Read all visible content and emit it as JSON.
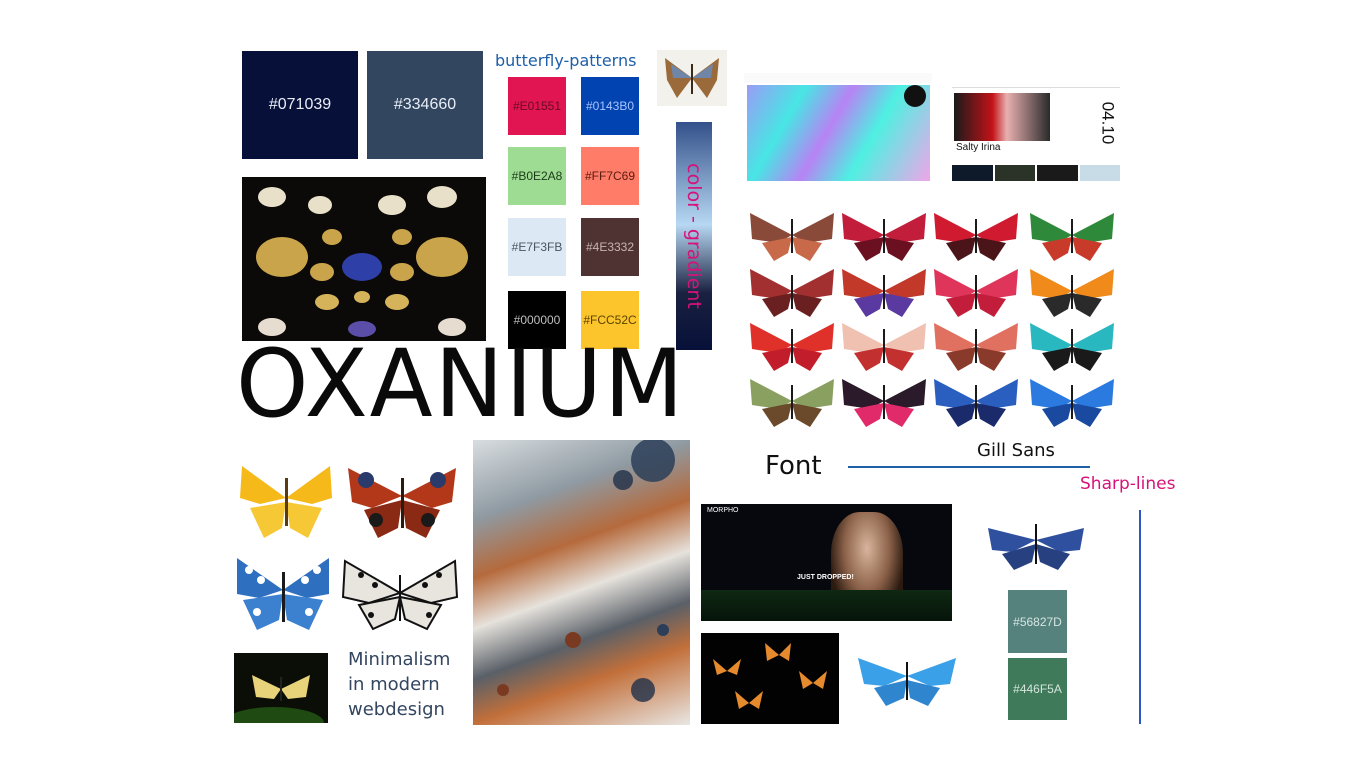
{
  "headline": "OXANIUM",
  "patterns_title": "butterfly-patterns",
  "gradient_label": "color - gradient",
  "font_label": "Font",
  "font_name": "Gill Sans",
  "sharp_lines_label": "Sharp-lines",
  "minimalism_text": [
    "Minimalism",
    "in modern",
    "webdesign"
  ],
  "large_swatches": [
    {
      "hex": "#071039",
      "label": "#071039"
    },
    {
      "hex": "#334660",
      "label": "#334660"
    }
  ],
  "pattern_swatches": [
    {
      "hex": "#E01551",
      "label": "#E01551"
    },
    {
      "hex": "#0143B0",
      "label": "#0143B0"
    },
    {
      "hex": "#B0E2A8",
      "label": "#B0E2A8"
    },
    {
      "hex": "#FF7C69",
      "label": "#FF7C69"
    },
    {
      "hex": "#E7F3FB",
      "label": "#E7F3FB"
    },
    {
      "hex": "#4E3332",
      "label": "#4E3332"
    },
    {
      "hex": "#000000",
      "label": "#000000"
    },
    {
      "hex": "#FCC52C",
      "label": "#FCC52C"
    }
  ],
  "green_swatches": [
    {
      "hex": "#56827D",
      "label": "#56827D"
    },
    {
      "hex": "#446F5A",
      "label": "#446F5A"
    }
  ],
  "web_mockup_1": {
    "big_number": "04.10",
    "artist": "Salty Irina"
  },
  "web_mockup_2": {
    "brand": "MORPHO",
    "banner": "JUST DROPPED!"
  },
  "colors": {
    "accent_pink": "#d6127a",
    "accent_blue": "#1d5fa8",
    "navy": "#071039"
  }
}
